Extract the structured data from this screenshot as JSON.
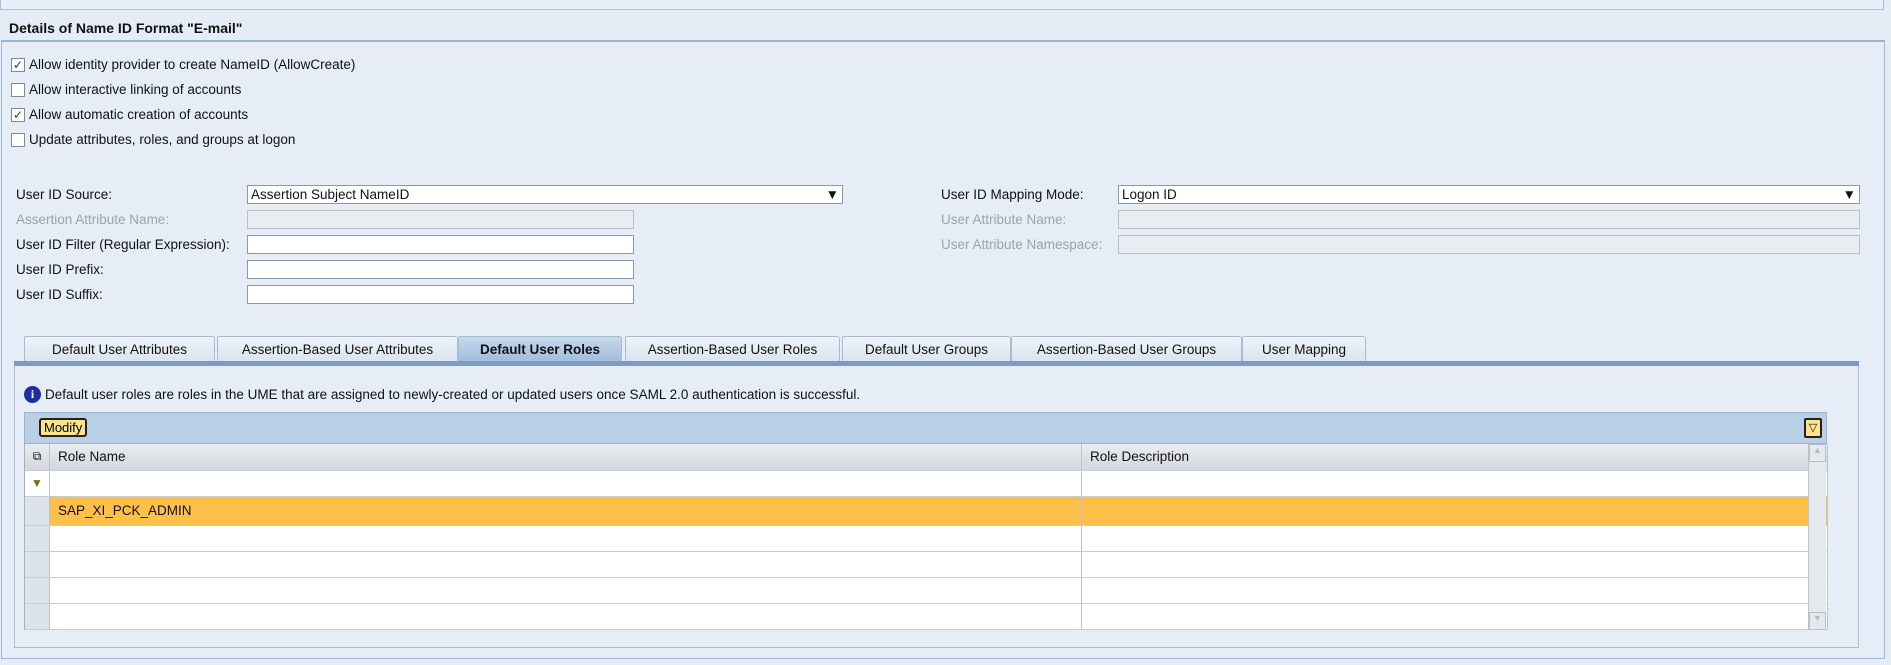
{
  "section_title": "Details of Name ID Format \"E-mail\"",
  "checkboxes": [
    {
      "label": "Allow identity provider to create NameID (AllowCreate)",
      "checked": true
    },
    {
      "label": "Allow interactive linking of accounts",
      "checked": false
    },
    {
      "label": "Allow automatic creation of accounts",
      "checked": true
    },
    {
      "label": "Update attributes, roles, and groups at logon",
      "checked": false
    }
  ],
  "form": {
    "user_id_source": {
      "label": "User ID Source:",
      "value": "Assertion Subject NameID"
    },
    "assertion_attribute_name": {
      "label": "Assertion Attribute Name:",
      "value": ""
    },
    "user_id_filter": {
      "label": "User ID Filter (Regular Expression):",
      "value": ""
    },
    "user_id_prefix": {
      "label": "User ID Prefix:",
      "value": ""
    },
    "user_id_suffix": {
      "label": "User ID Suffix:",
      "value": ""
    },
    "user_id_mapping_mode": {
      "label": "User ID Mapping Mode:",
      "value": "Logon ID"
    },
    "user_attribute_name": {
      "label": "User Attribute Name:",
      "value": ""
    },
    "user_attribute_namespace": {
      "label": "User Attribute Namespace:",
      "value": ""
    }
  },
  "tabs": [
    "Default User Attributes",
    "Assertion-Based User Attributes",
    "Default User Roles",
    "Assertion-Based User Roles",
    "Default User Groups",
    "Assertion-Based User Groups",
    "User Mapping"
  ],
  "active_tab": "Default User Roles",
  "info_text": "Default user roles are roles in the UME that are assigned to newly-created or updated users once SAML 2.0 authentication is successful.",
  "table": {
    "modify_label": "Modify",
    "columns": [
      "Role Name",
      "Role Description"
    ],
    "rows": [
      {
        "role_name": "SAP_XI_PCK_ADMIN",
        "role_description": ""
      }
    ],
    "selected_color": "#ffc04a"
  }
}
